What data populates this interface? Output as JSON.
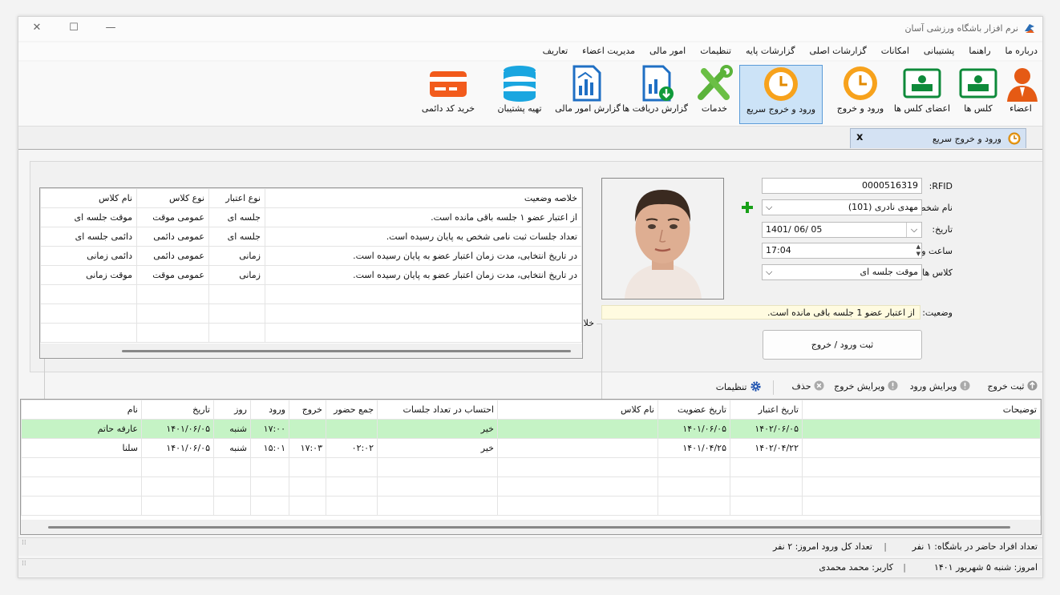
{
  "window": {
    "title": "نرم افزار باشگاه ورزشی آسان"
  },
  "menu": [
    "تعاریف",
    "مدیریت اعضاء",
    "امور مالی",
    "تنظیمات",
    "گزارشات پایه",
    "گزارشات اصلی",
    "امکانات",
    "پشتیبانی",
    "راهنما",
    "درباره ما"
  ],
  "ribbon": [
    {
      "label": "اعضاء",
      "icon": "member-icon"
    },
    {
      "label": "کلس ها",
      "icon": "class-icon"
    },
    {
      "label": "اعضای کلس ها",
      "icon": "class-members-icon"
    },
    {
      "label": "ورود و خروج",
      "icon": "clock-icon"
    },
    {
      "label": "ورود و خروج سریع",
      "icon": "clock-icon"
    },
    {
      "label": "خدمات",
      "icon": "tools-icon"
    },
    {
      "label": "گزارش دریافت ها",
      "icon": "receipts-report-icon"
    },
    {
      "label": "گزارش امور مالی",
      "icon": "finance-report-icon"
    },
    {
      "label": "تهیه پشتیبان",
      "icon": "database-icon"
    },
    {
      "label": "خرید کد دائمی",
      "icon": "card-icon"
    }
  ],
  "tab": {
    "title": "ورود و خروج سریع",
    "close": "x"
  },
  "form": {
    "rfid_label": "RFID:",
    "rfid": "0000516319",
    "person_label": "نام شخص:",
    "person": "مهدی نادری (101)",
    "date_label": "تاریخ:",
    "date": "1401/ 06/ 05",
    "time_label": "ساعت ورود:",
    "time": "17:04",
    "classes_label": "کلاس های دارای اعتبار:",
    "class": "موقت جلسه ای",
    "status_label": "وضعیت:",
    "status": "از اعتبار عضو 1 جلسه باقی مانده است.",
    "submit": "ثبت ورود / خروج"
  },
  "summary": {
    "legend": "خلاصه وضعیت",
    "headers": [
      "نام کلاس",
      "نوع کلاس",
      "نوع اعتبار",
      "خلاصه وضعیت"
    ],
    "rows": [
      [
        "موقت جلسه ای",
        "عمومی موقت",
        "جلسه ای",
        "از اعتبار عضو ۱ جلسه باقی مانده است."
      ],
      [
        "دائمی جلسه ای",
        "عمومی دائمی",
        "جلسه ای",
        "تعداد جلسات ثبت نامی شخص به پایان رسیده است."
      ],
      [
        "دائمی زمانی",
        "عمومی دائمی",
        "زمانی",
        "در تاریخ انتخابی، مدت زمان اعتبار عضو به پایان رسیده است."
      ],
      [
        "موقت زمانی",
        "عمومی موقت",
        "زمانی",
        "در تاریخ انتخابی، مدت زمان اعتبار عضو به پایان رسیده است."
      ]
    ]
  },
  "toolbar": {
    "exit": "ثبت خروج",
    "edit_entry": "ویرایش ورود",
    "edit_exit": "ویرایش خروج",
    "delete": "حذف",
    "settings": "تنظیمات"
  },
  "grid": {
    "headers": [
      "نام",
      "تاریخ",
      "روز",
      "ورود",
      "خروج",
      "جمع حضور",
      "احتساب در تعداد جلسات",
      "نام کلاس",
      "تاریخ عضویت",
      "تاریخ اعتبار",
      "توضیحات"
    ],
    "rows": [
      [
        "عارفه حاتم",
        "۱۴۰۱/۰۶/۰۵",
        "شنبه",
        "۱۷:۰۰",
        "",
        "",
        "خیر",
        "",
        "۱۴۰۱/۰۶/۰۵",
        "۱۴۰۲/۰۶/۰۵",
        ""
      ],
      [
        "سلنا",
        "۱۴۰۱/۰۶/۰۵",
        "شنبه",
        "۱۵:۰۱",
        "۱۷:۰۳",
        "۰۲:۰۲",
        "خیر",
        "",
        "۱۴۰۱/۰۴/۲۵",
        "۱۴۰۲/۰۴/۲۲",
        ""
      ]
    ]
  },
  "statusbar1": {
    "present": "تعداد افراد حاضر در باشگاه: ۱ نفر",
    "total": "تعداد کل ورود امروز: ۲ نفر"
  },
  "statusbar2": {
    "today": "امروز: شنبه ۵ شهریور ۱۴۰۱",
    "user": "کاربر: محمد محمدی"
  }
}
